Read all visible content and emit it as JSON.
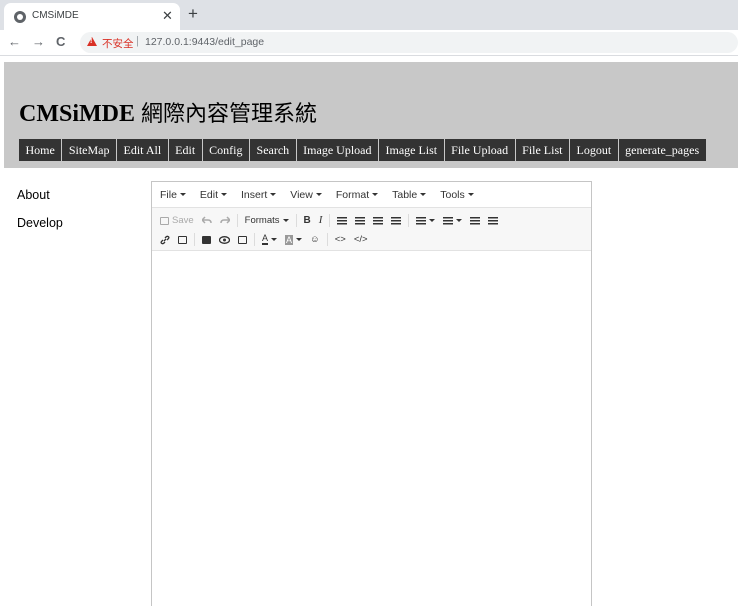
{
  "browser": {
    "tab_title": "CMSiMDE",
    "tab_close": "✕",
    "new_tab": "+",
    "back": "←",
    "forward": "→",
    "reload": "C",
    "security_label": "不安全",
    "separator": "|",
    "url": "127.0.0.1:9443/edit_page"
  },
  "site": {
    "title_latin": "CMSiMDE",
    "title_cjk": "網際內容管理系統"
  },
  "menu": [
    "Home",
    "SiteMap",
    "Edit All",
    "Edit",
    "Config",
    "Search",
    "Image Upload",
    "Image List",
    "File Upload",
    "File List",
    "Logout",
    "generate_pages"
  ],
  "sidebar": [
    "About",
    "Develop"
  ],
  "editor": {
    "menubar": [
      "File",
      "Edit",
      "Insert",
      "View",
      "Format",
      "Table",
      "Tools"
    ],
    "toolbar": {
      "save": "Save",
      "formats": "Formats",
      "bold": "B",
      "italic": "I",
      "font_color": "A",
      "bg_color": "A",
      "emoticons": "☺",
      "code": "<>",
      "source": "</>"
    }
  }
}
